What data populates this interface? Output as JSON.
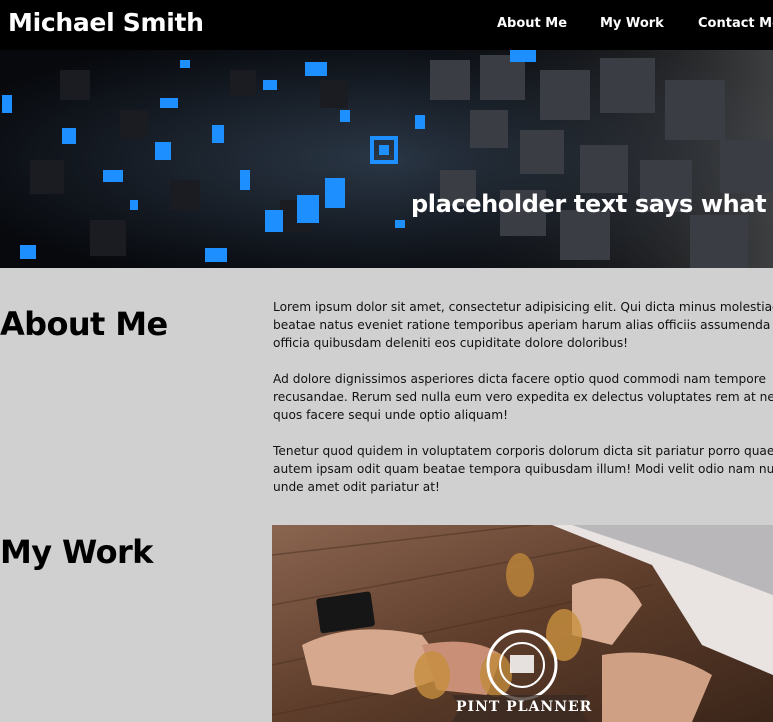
{
  "header": {
    "brand": "Michael Smith",
    "nav": [
      {
        "label": "About Me"
      },
      {
        "label": "My Work"
      },
      {
        "label": "Contact Me"
      }
    ]
  },
  "hero": {
    "caption": "placeholder text says what"
  },
  "about": {
    "heading": "About Me",
    "paragraphs": [
      {
        "lines": [
          "Lorem ipsum dolor sit amet, consectetur adipisicing elit. Qui dicta minus molestiae vel",
          "beatae natus eveniet ratione temporibus aperiam harum alias officiis assumenda",
          "officia quibusdam deleniti eos cupiditate dolore doloribus!"
        ]
      },
      {
        "lines": [
          "Ad dolore dignissimos asperiores dicta facere optio quod commodi nam tempore",
          "recusandae. Rerum sed nulla eum vero expedita ex delectus voluptates rem at neque",
          "quos facere sequi unde optio aliquam!"
        ]
      },
      {
        "lines": [
          "Tenetur quod quidem in voluptatem corporis dolorum dicta sit pariatur porro quaerat",
          "autem ipsam odit quam beatae tempora quibusdam illum! Modi velit odio nam nulla",
          "unde amet odit pariatur at!"
        ]
      }
    ]
  },
  "work": {
    "heading": "My Work",
    "project_logo_text": "PINT PLANNER"
  },
  "colors": {
    "topbar": "#000000",
    "page_background": "#d0d0d0",
    "hero_accent": "#1e8fff"
  }
}
